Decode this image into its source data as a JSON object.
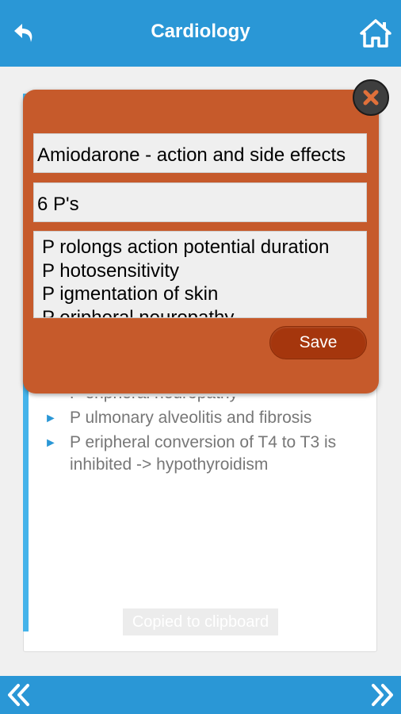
{
  "header": {
    "title": "Cardiology",
    "back_icon": "back-arrow-icon",
    "home_icon": "home-icon",
    "color": "#2a97d6"
  },
  "card": {
    "bullets": [
      {
        "text": "P eripheral neuropathy"
      },
      {
        "text": "P ulmonary alveolitis and fibrosis"
      },
      {
        "text": "P eripheral conversion of T4 to T3 is inhibited -> hypothyroidism"
      }
    ],
    "accent_color": "#45b3ea"
  },
  "toast": {
    "text": "Copied to clipboard"
  },
  "footer": {
    "prev_icon": "double-chevron-left-icon",
    "next_icon": "double-chevron-right-icon"
  },
  "dialog": {
    "title_value": "Amiodarone - action and side effects",
    "mnemonic_value": "6 P's",
    "notes_lines": [
      "P rolongs action potential duration",
      "P hotosensitivity",
      "P igmentation of skin",
      "P eripheral neuropathy"
    ],
    "save_label": "Save",
    "close_icon": "close-icon",
    "color": "#c65a2b",
    "button_color": "#a5360d"
  }
}
